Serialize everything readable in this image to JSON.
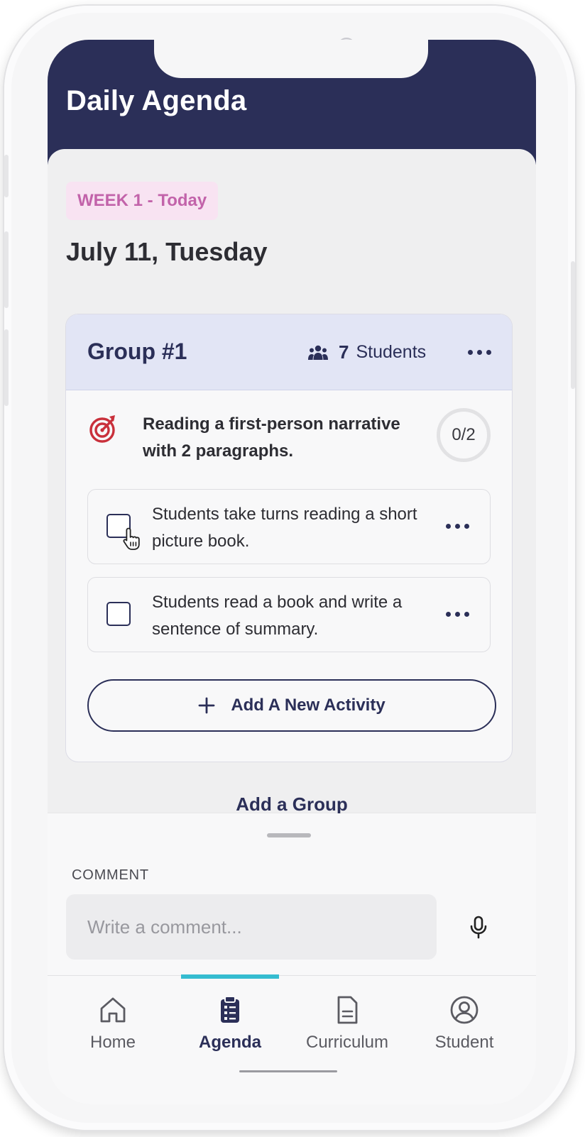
{
  "header": {
    "title": "Daily Agenda"
  },
  "week_badge": "WEEK 1 - Today",
  "date": "July 11, Tuesday",
  "group": {
    "name": "Group #1",
    "student_count": "7",
    "students_label": "Students",
    "objective": "Reading a first-person narrative with 2 paragraphs.",
    "progress": "0/2",
    "activities": [
      {
        "text": "Students take turns reading a short picture book."
      },
      {
        "text": "Students read a book and write a sentence of summary."
      }
    ],
    "add_activity_label": "Add A New Activity"
  },
  "add_group_label": "Add a Group",
  "comment": {
    "label": "COMMENT",
    "placeholder": "Write a comment...",
    "value": ""
  },
  "nav": {
    "items": [
      {
        "label": "Home",
        "icon": "home-icon"
      },
      {
        "label": "Agenda",
        "icon": "clipboard-icon"
      },
      {
        "label": "Curriculum",
        "icon": "document-icon"
      },
      {
        "label": "Student",
        "icon": "user-circle-icon"
      }
    ],
    "active": "Agenda"
  },
  "colors": {
    "primary": "#2b2f58",
    "accent": "#35bcd0",
    "badge_bg": "#f8e3f2",
    "badge_text": "#c263aa",
    "target_icon": "#c9303b"
  }
}
